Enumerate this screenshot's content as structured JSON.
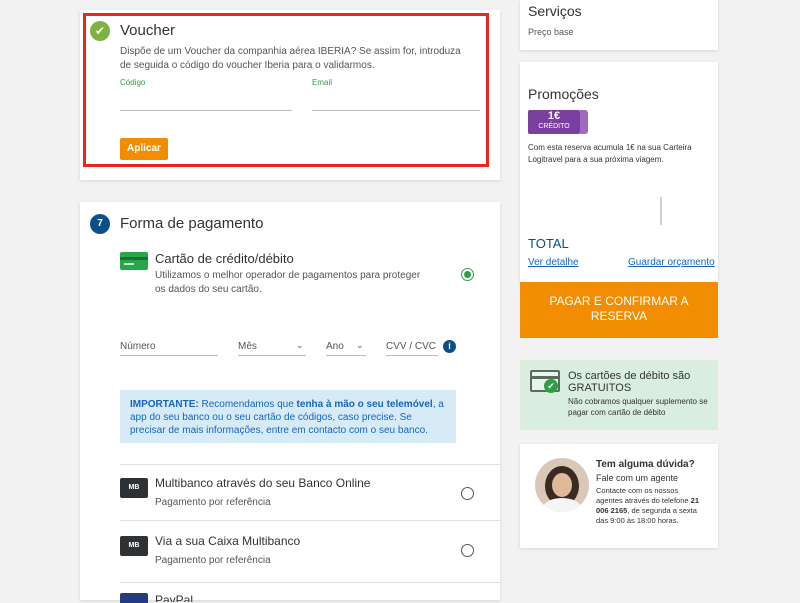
{
  "voucher": {
    "title": "Voucher",
    "description": "Dispõe de um Voucher da companhia aérea IBERIA? Se assim for, introduza de seguida o código do voucher Iberia para o validarmos.",
    "code_label": "Código",
    "email_label": "Email",
    "apply_label": "Aplicar"
  },
  "payment": {
    "step": "7",
    "title": "Forma de pagamento",
    "card_option": {
      "title": "Cartão de crédito/débito",
      "description": "Utilizamos o melhor operador de pagamentos para proteger os dados do seu cartão."
    },
    "fields": {
      "number": "Número",
      "month": "Mês",
      "year": "Ano",
      "cvv": "CVV / CVC"
    },
    "important": {
      "prefix": "IMPORTANTE:",
      "text1": " Recomendamos que ",
      "bold": "tenha à mão o seu telemóvel",
      "text2": ", a app do seu banco ou o seu cartão de códigos, caso precise. Se precisar de mais informações, entre em contacto com o seu banco."
    },
    "methods": [
      {
        "icon": "MB",
        "title": "Multibanco através do seu Banco Online",
        "subtitle": "Pagamento por referência"
      },
      {
        "icon": "MB",
        "title": "Via a sua Caixa Multibanco",
        "subtitle": "Pagamento por referência"
      },
      {
        "icon": "P",
        "title": "PayPal",
        "subtitle": ""
      }
    ]
  },
  "sidebar": {
    "services": {
      "title": "Serviços",
      "base_price": "Preço base"
    },
    "promos": {
      "title": "Promoções",
      "badge_value": "1€",
      "badge_label": "CRÉDITO",
      "text": "Com esta reserva acumula 1€ na sua Carteira Logitravel para a sua próxima viagem."
    },
    "total_label": "TOTAL",
    "detail_link": "Ver detalhe",
    "save_link": "Guardar orçamento",
    "pay_button": "PAGAR E CONFIRMAR A RESERVA",
    "debit": {
      "title": "Os cartões de débito são GRATUITOS",
      "text": "Não cobramos qualquer suplemento se pagar com cartão de débito"
    },
    "help": {
      "title": "Tem alguma dúvida?",
      "subtitle": "Fale com um agente",
      "text1": "Contacte com os nossos agentes através do telefone ",
      "phone": "21 006 2165",
      "text2": ", de segunda a sexta das 9:00 às 18:00 horas."
    }
  },
  "colors": {
    "accent_orange": "#f28c00",
    "green": "#2e9e44",
    "blue_badge": "#0a4f8a",
    "purple": "#7b3fa0",
    "info_bg": "#d7ebf7",
    "debit_bg": "#d9eedf",
    "voucher_border": "#e8261c"
  }
}
